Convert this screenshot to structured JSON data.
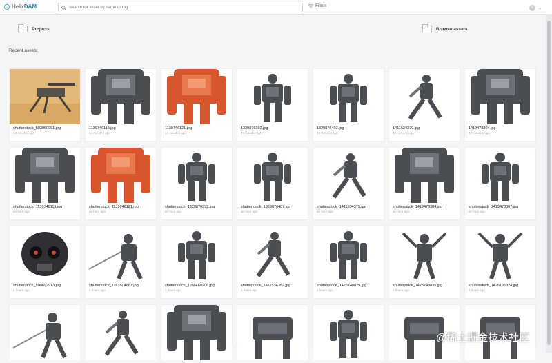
{
  "app": {
    "logo_a": "Helix",
    "logo_b": "DAM"
  },
  "search": {
    "placeholder": "Search for asset by name or tag"
  },
  "toolbar": {
    "filters_label": "Filters"
  },
  "user": {
    "avatar_initials": "U"
  },
  "shortcuts": {
    "projects_label": "Projects",
    "browse_label": "Browse assets"
  },
  "main": {
    "section_title": "Recent assets"
  },
  "assets": [
    {
      "name": "shutterstock_583960951.jpg",
      "time": "38 minutes ago",
      "thumb": "robot-desert",
      "bg": "#e2b878"
    },
    {
      "name": "1139746115.jpg",
      "time": "44 minutes ago",
      "thumb": "robot-torso-gray",
      "bg": "#ffffff"
    },
    {
      "name": "1139746121.jpg",
      "time": "44 minutes ago",
      "thumb": "robot-torso-orange",
      "bg": "#ffffff"
    },
    {
      "name": "1329876392.jpg",
      "time": "44 minutes ago",
      "thumb": "robot-stand",
      "bg": "#ffffff"
    },
    {
      "name": "1329876407.jpg",
      "time": "44 minutes ago",
      "thumb": "robot-stand",
      "bg": "#ffffff"
    },
    {
      "name": "1411534379.jpg",
      "time": "44 minutes ago",
      "thumb": "robot-run",
      "bg": "#ffffff"
    },
    {
      "name": "1419478304.jpg",
      "time": "44 minutes ago",
      "thumb": "robot-close",
      "bg": "#ffffff"
    },
    {
      "name": "shutterstock_1139746115.jpg",
      "time": "an hour ago",
      "thumb": "robot-torso-gray",
      "bg": "#ffffff"
    },
    {
      "name": "shutterstock_1139746121.jpg",
      "time": "an hour ago",
      "thumb": "robot-torso-orange",
      "bg": "#ffffff"
    },
    {
      "name": "shutterstock_1329876392.jpg",
      "time": "an hour ago",
      "thumb": "robot-stand",
      "bg": "#ffffff"
    },
    {
      "name": "shutterstock_1329876407.jpg",
      "time": "an hour ago",
      "thumb": "robot-stand",
      "bg": "#ffffff"
    },
    {
      "name": "shutterstock_1411534379.jpg",
      "time": "an hour ago",
      "thumb": "robot-run",
      "bg": "#ffffff"
    },
    {
      "name": "shutterstock_1419478304.jpg",
      "time": "an hour ago",
      "thumb": "robot-close",
      "bg": "#ffffff"
    },
    {
      "name": "shutterstock_1419478307.jpg",
      "time": "an hour ago",
      "thumb": "robot-stand",
      "bg": "#ffffff"
    },
    {
      "name": "shutterstock_590692913.jpg",
      "time": "2 hours ago",
      "thumb": "robot-helmet",
      "bg": "#ffffff"
    },
    {
      "name": "shutterstock_1163504887.jpg",
      "time": "2 hours ago",
      "thumb": "robot-sword",
      "bg": "#ffffff"
    },
    {
      "name": "shutterstock_1166460208.jpg",
      "time": "2 hours ago",
      "thumb": "robot-stand",
      "bg": "#ffffff"
    },
    {
      "name": "shutterstock_1411534382.jpg",
      "time": "2 hours ago",
      "thumb": "robot-run",
      "bg": "#ffffff"
    },
    {
      "name": "shutterstock_1425748829.jpg",
      "time": "2 hours ago",
      "thumb": "robot-stand",
      "bg": "#ffffff"
    },
    {
      "name": "shutterstock_1425748835.jpg",
      "time": "2 hours ago",
      "thumb": "robot-arms",
      "bg": "#ffffff"
    },
    {
      "name": "shutterstock_1426195328.jpg",
      "time": "2 hours ago",
      "thumb": "robot-arms",
      "bg": "#ffffff"
    },
    {
      "name": "",
      "time": "",
      "thumb": "robot-sword",
      "bg": "#ffffff"
    },
    {
      "name": "",
      "time": "",
      "thumb": "robot-run",
      "bg": "#ffffff"
    },
    {
      "name": "",
      "time": "",
      "thumb": "robot-close",
      "bg": "#ffffff"
    },
    {
      "name": "",
      "time": "",
      "thumb": "robot-mech",
      "bg": "#ffffff"
    },
    {
      "name": "",
      "time": "",
      "thumb": "robot-stand",
      "bg": "#ffffff"
    },
    {
      "name": "",
      "time": "",
      "thumb": "robot-mech",
      "bg": "#ffffff"
    },
    {
      "name": "",
      "time": "",
      "thumb": "robot-mech",
      "bg": "#ffffff"
    }
  ],
  "watermark": "@稀土掘金技术社区"
}
